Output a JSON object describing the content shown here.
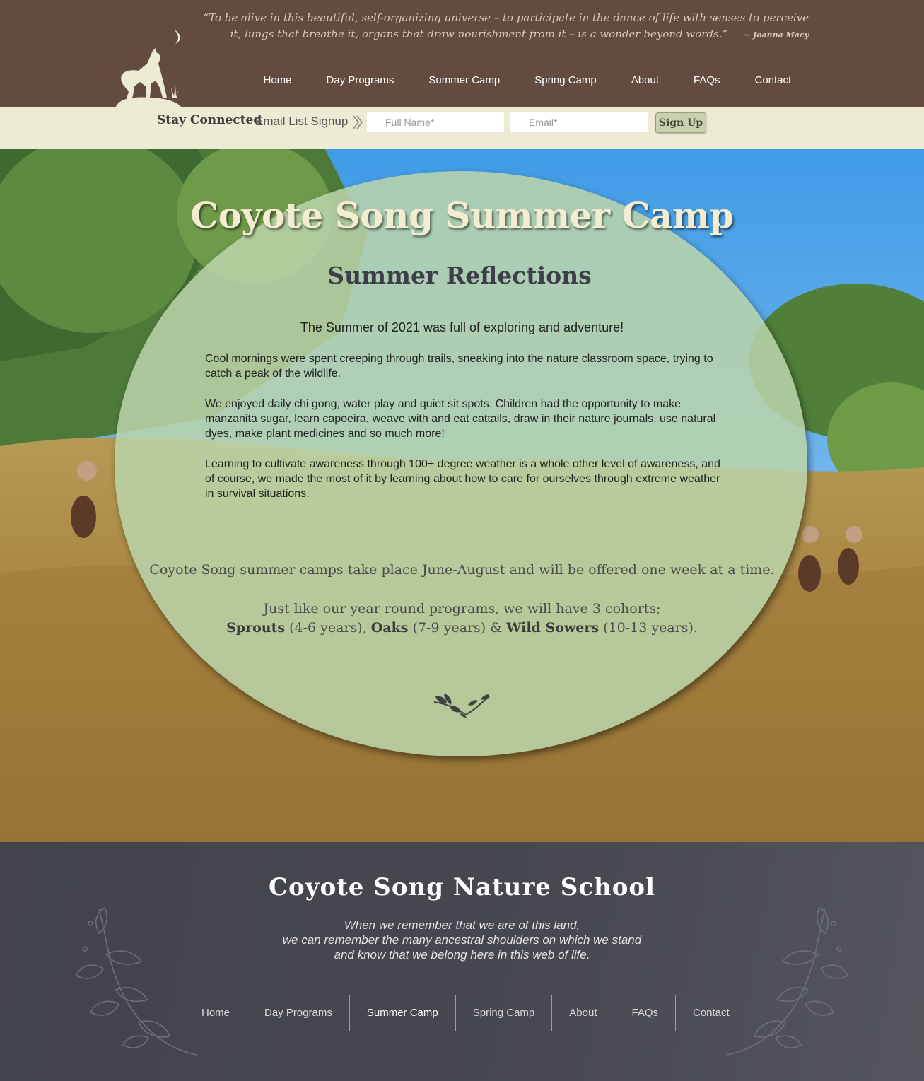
{
  "header": {
    "quote_text": "“To be alive in this beautiful, self-organizing universe – to participate in the dance of life with senses to perceive it, lungs that breathe it, organs that draw nourishment from it – is a wonder beyond words.”",
    "quote_author": "~ Joanna Macy",
    "nav": [
      "Home",
      "Day Programs",
      "Summer Camp",
      "Spring Camp",
      "About",
      "FAQs",
      "Contact"
    ]
  },
  "signup": {
    "title": "Stay Connected",
    "subtitle": "Email List Signup",
    "name_placeholder": "Full Name*",
    "email_placeholder": "Email*",
    "button": "Sign Up"
  },
  "hero": {
    "title": "Coyote Song Summer Camp",
    "subtitle": "Summer Reflections",
    "intro": "The Summer of 2021 was full of exploring and adventure!",
    "paragraphs": [
      "Cool mornings were spent creeping through trails, sneaking into the nature classroom space, trying to catch a peak of the wildlife.",
      "We enjoyed daily chi gong, water play and quiet sit spots. Children had the opportunity to make manzanita sugar, learn capoeira, weave with and eat cattails, draw in their nature journals, use natural dyes, make plant medicines and so much more!",
      "Learning to cultivate awareness through 100+ degree weather is a whole other level of awareness, and of course, we made the most of it by learning about how to care for ourselves through extreme weather in survival situations."
    ],
    "camp_info": "Coyote Song summer camps take place June-August and will be offered one week at a time.",
    "cohorts_intro": "Just like our year round programs, we will have 3 cohorts;",
    "cohorts": [
      {
        "name": "Sprouts",
        "ages": "(4-6 years),"
      },
      {
        "name": "Oaks",
        "ages": "(7-9 years) &"
      },
      {
        "name": "Wild Sowers",
        "ages": "(10-13 years)."
      }
    ]
  },
  "footer": {
    "title": "Coyote Song Nature School",
    "poem": [
      "When we remember that we are of this land,",
      "we can remember the many ancestral shoulders on which we stand",
      "and know that we belong here in this web of life."
    ],
    "nav": [
      "Home",
      "Day Programs",
      "Summer Camp",
      "Spring Camp",
      "About",
      "FAQs",
      "Contact"
    ],
    "active_nav": "Summer Camp"
  },
  "colors": {
    "header_bg": "#634b40",
    "signup_bg": "#eeebd4",
    "oval_fill": "#bad4aa",
    "footer_bg": "#42434b"
  }
}
